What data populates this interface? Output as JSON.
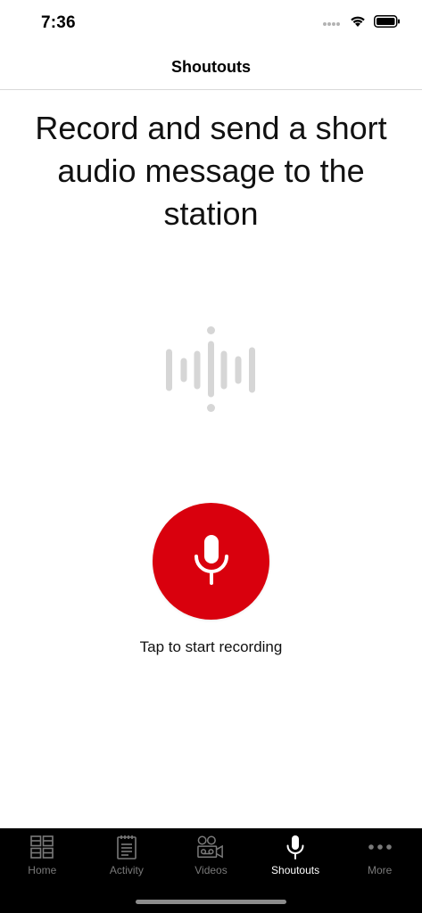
{
  "status_bar": {
    "time": "7:36",
    "icons": [
      "signal-dots-icon",
      "wifi-icon",
      "battery-icon"
    ]
  },
  "nav": {
    "title": "Shoutouts"
  },
  "main": {
    "headline": "Record and send a short audio message to the station",
    "waveform_icon": "waveform-icon",
    "record_button_icon": "microphone-icon",
    "record_hint": "Tap to start recording"
  },
  "tabs": [
    {
      "label": "Home",
      "icon": "grid-icon",
      "active": false
    },
    {
      "label": "Activity",
      "icon": "notepad-icon",
      "active": false
    },
    {
      "label": "Videos",
      "icon": "video-camera-icon",
      "active": false
    },
    {
      "label": "Shoutouts",
      "icon": "microphone-icon",
      "active": true
    },
    {
      "label": "More",
      "icon": "more-dots-icon",
      "active": false
    }
  ],
  "colors": {
    "accent_red": "#d9000d",
    "tab_bar_bg": "#000000",
    "tab_inactive": "#7a7a7a",
    "tab_active": "#ffffff",
    "waveform_gray": "#d6d6d6"
  }
}
